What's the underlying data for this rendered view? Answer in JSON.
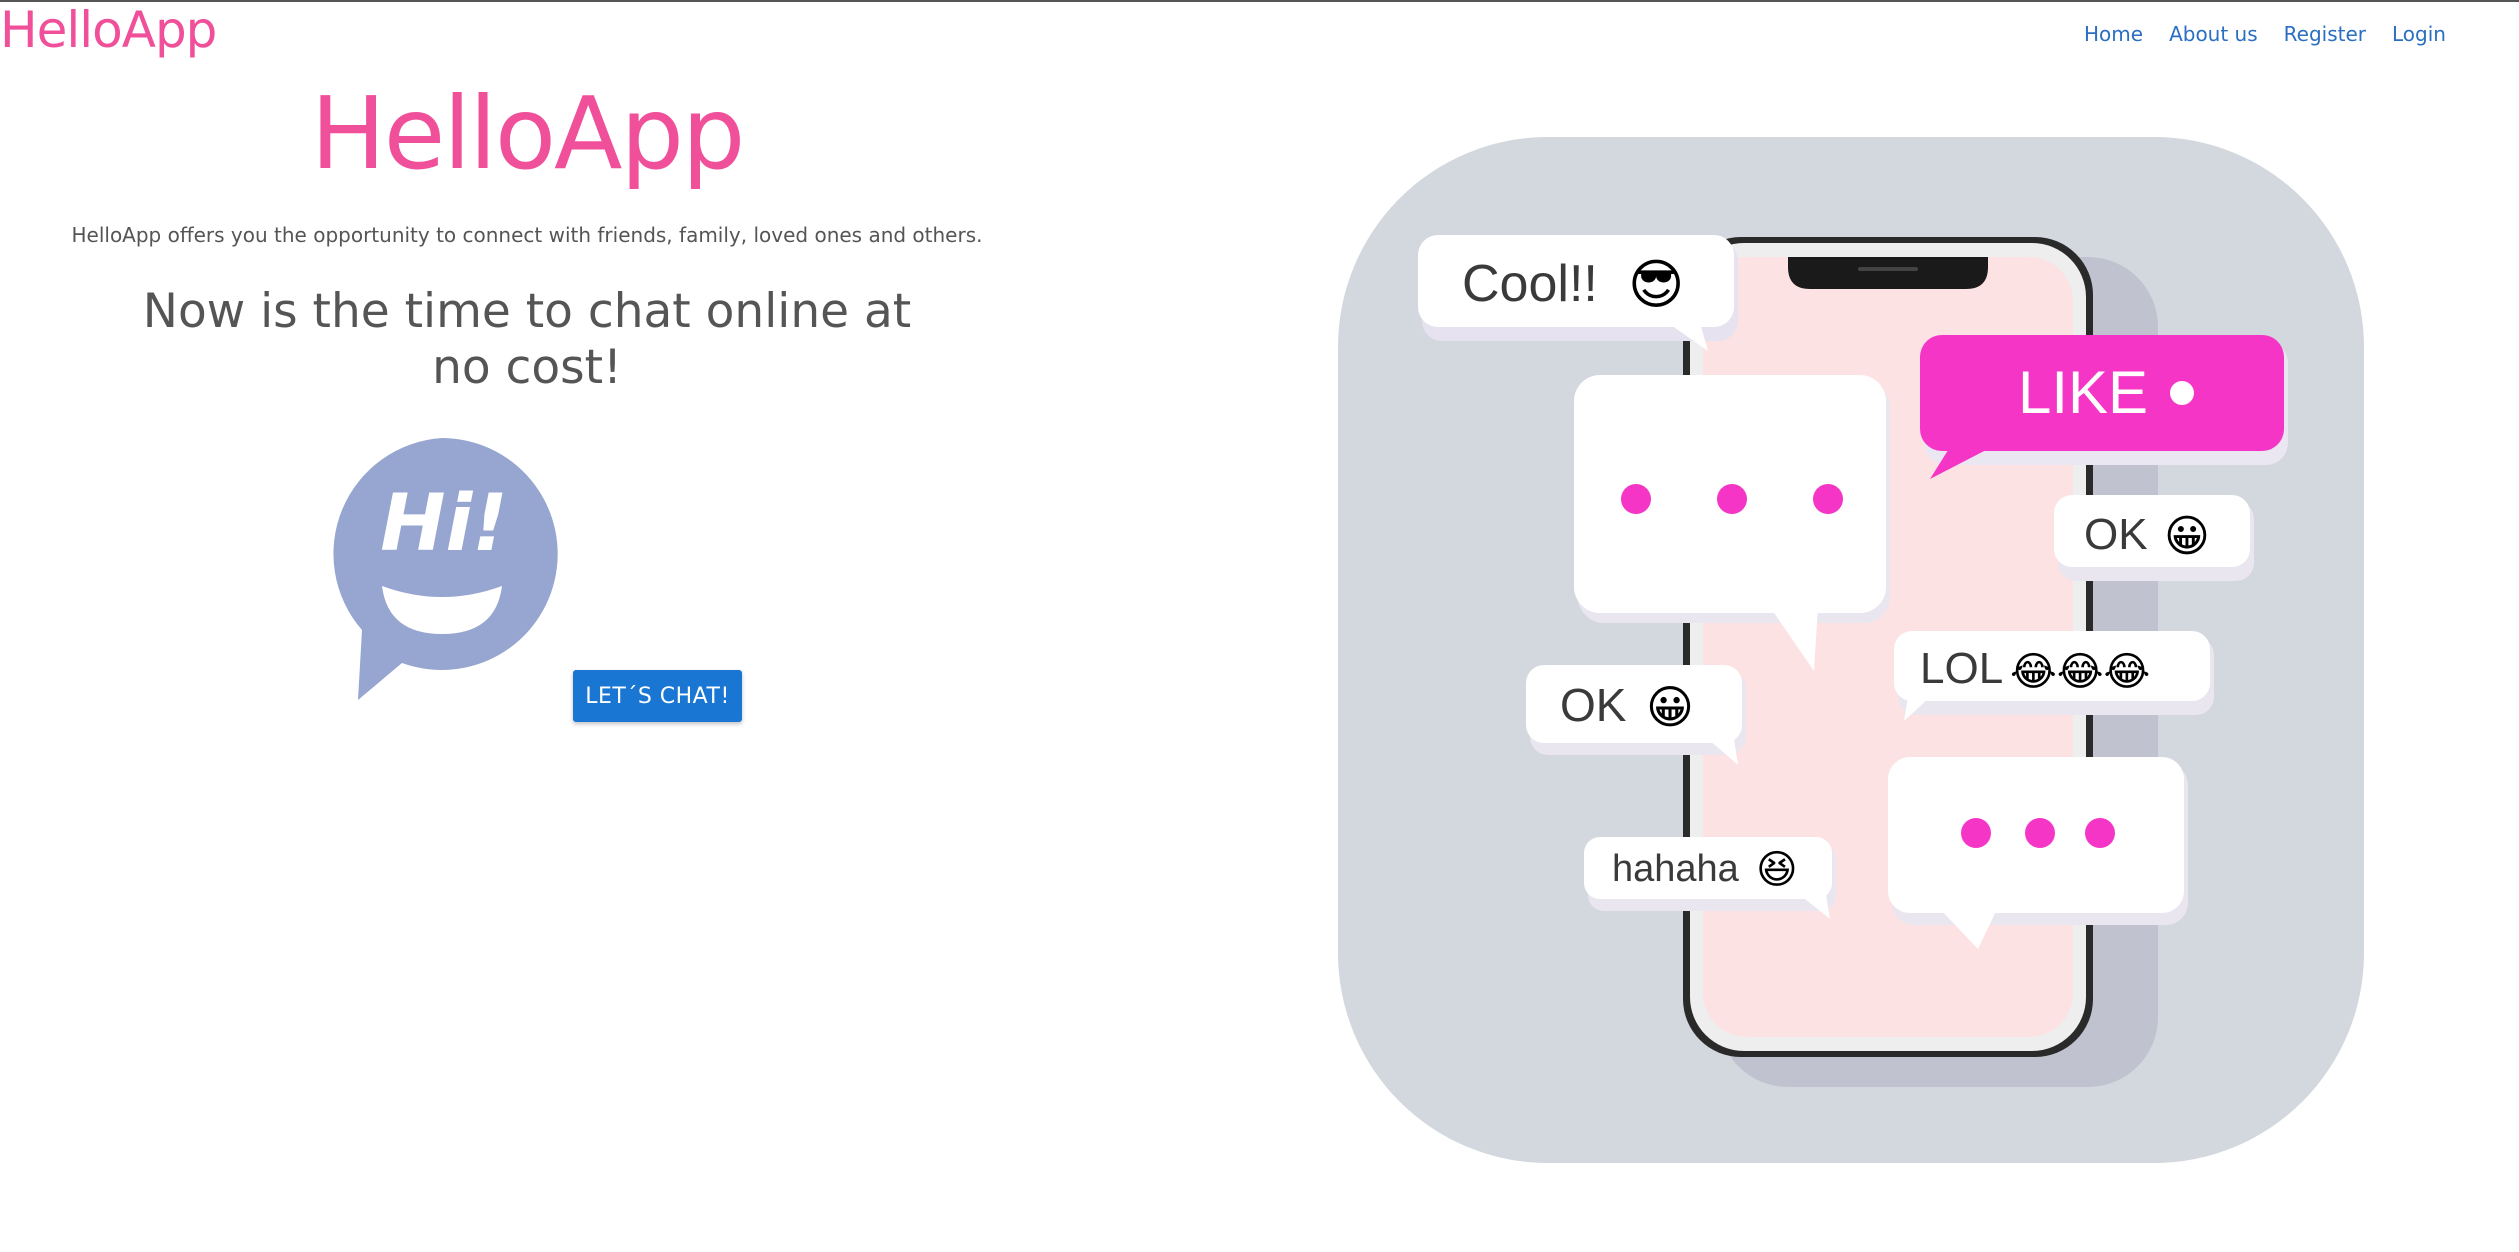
{
  "app": {
    "brand": "HelloApp"
  },
  "nav": {
    "items": [
      "Home",
      "About us",
      "Register",
      "Login"
    ]
  },
  "hero": {
    "title": "HelloApp",
    "description": "HelloApp offers you the opportunity to connect with friends, family, loved ones and others.",
    "tagline": "Now is the time to chat online at no cost!",
    "button_label": "LET´S CHAT!",
    "bubble_text": "Hi!"
  },
  "illustration": {
    "bubbles": {
      "cool": "Cool!!",
      "like": "LIKE",
      "ok_right": "OK",
      "lol": "LOL",
      "ok_left": "OK",
      "hahaha": "hahaha"
    },
    "emojis": {
      "cool": "😎",
      "ok_right": "😀",
      "lol": "😂😂😂",
      "ok_left": "😀",
      "hahaha": "😆"
    }
  },
  "colors": {
    "brand_pink": "#f0509a",
    "link_blue": "#2b6fc2",
    "button_blue": "#1976d2",
    "bubble_purple": "#96a6d0",
    "magenta": "#f535c6",
    "panel_gray": "#d3d7de"
  }
}
